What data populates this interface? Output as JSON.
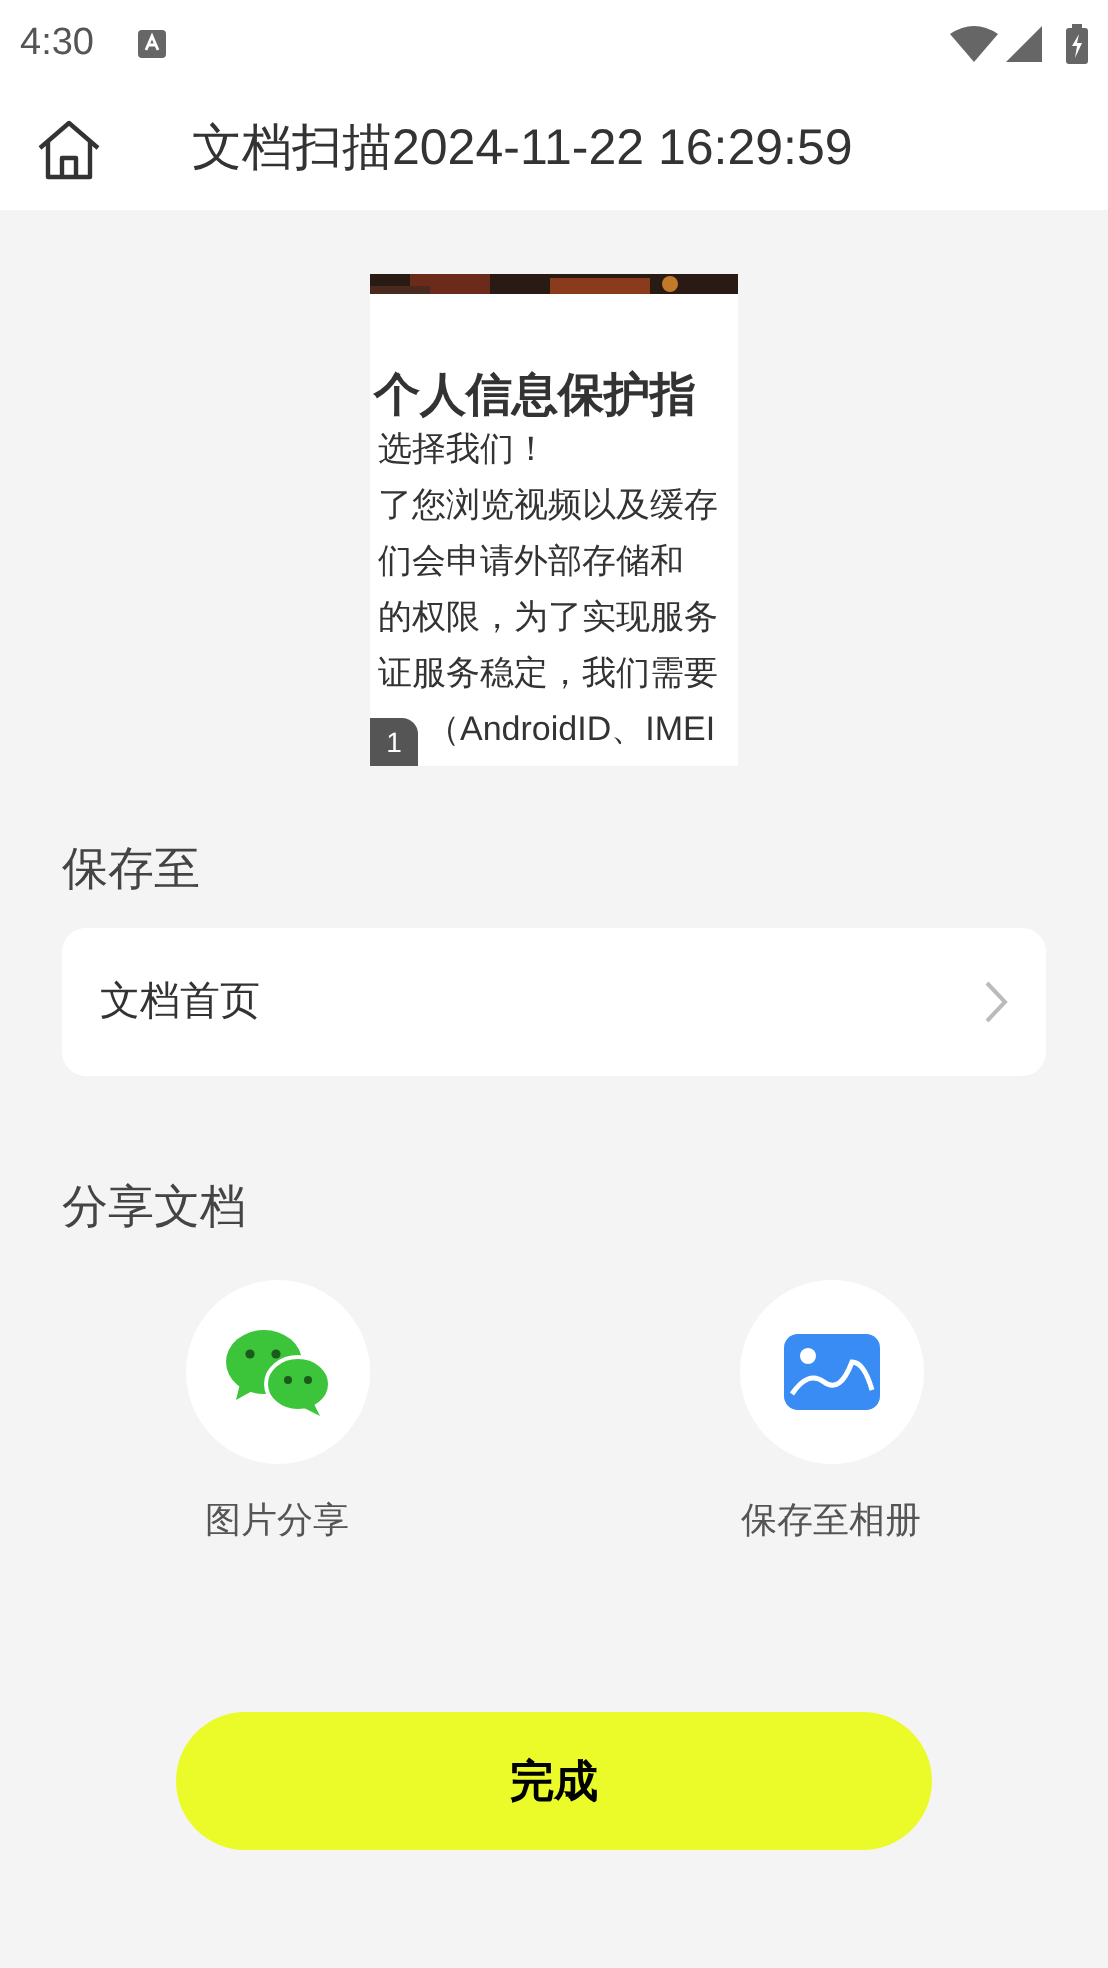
{
  "status_bar": {
    "time": "4:30"
  },
  "app_bar": {
    "title": "文档扫描2024-11-22 16:29:59"
  },
  "preview": {
    "heading": "个人信息保护指",
    "lines": [
      "选择我们！",
      "了您浏览视频以及缓存",
      "们会申请外部存储和",
      "的权限，为了实现服务",
      "证服务稳定，我们需要",
      "（AndroidID、IMEI"
    ],
    "page_badge": "1"
  },
  "save_section": {
    "title": "保存至",
    "destination": "文档首页"
  },
  "share_section": {
    "title": "分享文档",
    "options": [
      {
        "kind": "chat",
        "label": "图片分享"
      },
      {
        "kind": "album",
        "label": "保存至相册"
      }
    ]
  },
  "done_button": "完成"
}
